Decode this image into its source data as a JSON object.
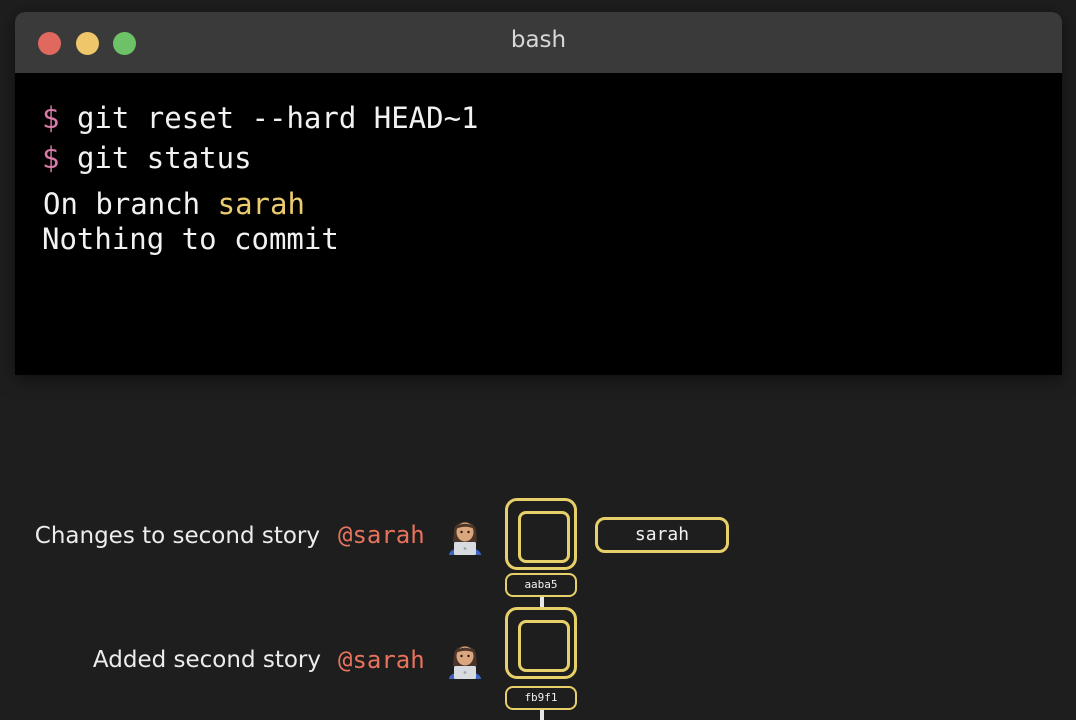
{
  "window": {
    "title": "bash"
  },
  "terminal": {
    "commands": [
      {
        "prompt": "$",
        "text": "git reset --hard HEAD~1"
      },
      {
        "prompt": "$",
        "text": "git status"
      }
    ],
    "output": {
      "branch_prefix": "On branch ",
      "branch_name": "sarah",
      "status_line": "Nothing to commit"
    }
  },
  "commits": [
    {
      "message": "Changes to second story",
      "author": "@sarah",
      "avatar_icon": "woman-technologist-icon",
      "hash": "aaba5"
    },
    {
      "message": "Added second story",
      "author": "@sarah",
      "avatar_icon": "woman-technologist-icon",
      "hash": "fb9f1"
    }
  ],
  "branch_pointer": {
    "label": "sarah"
  },
  "colors": {
    "prompt": "#d97ba7",
    "branch_highlight": "#ebcc6e",
    "author": "#e8735d",
    "node_border": "#e7d06a"
  }
}
